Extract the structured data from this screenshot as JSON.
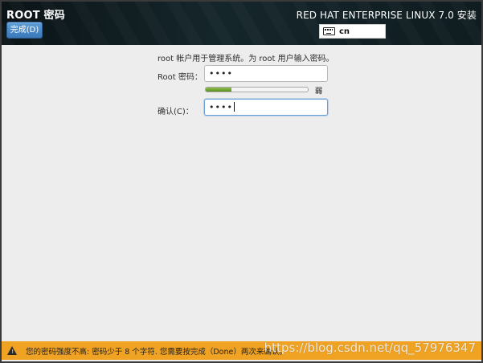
{
  "header": {
    "screen_title": "ROOT 密码",
    "done_button": "完成(D)",
    "product_title": "RED HAT ENTERPRISE LINUX 7.0 安装",
    "keyboard_layout": "cn"
  },
  "form": {
    "description": "root 帐户用于管理系统。为 root 用户输入密码。",
    "password_label": "Root 密码：",
    "password_value": "••••",
    "strength_level": 0.25,
    "strength_text": "弱",
    "confirm_label": "确认(C)：",
    "confirm_value": "••••"
  },
  "warning": {
    "icon": "warning-icon",
    "text": "您的密码强度不高: 密码少于 8 个字符. 您需要按完成（Done）两次来确认。"
  },
  "watermark": "https://blog.csdn.net/qq_57976347",
  "colors": {
    "header_bg": "#15262b",
    "done_button": "#3a78b8",
    "warning_bg": "#f0a323",
    "strength_fill": "#6a9a2e"
  }
}
